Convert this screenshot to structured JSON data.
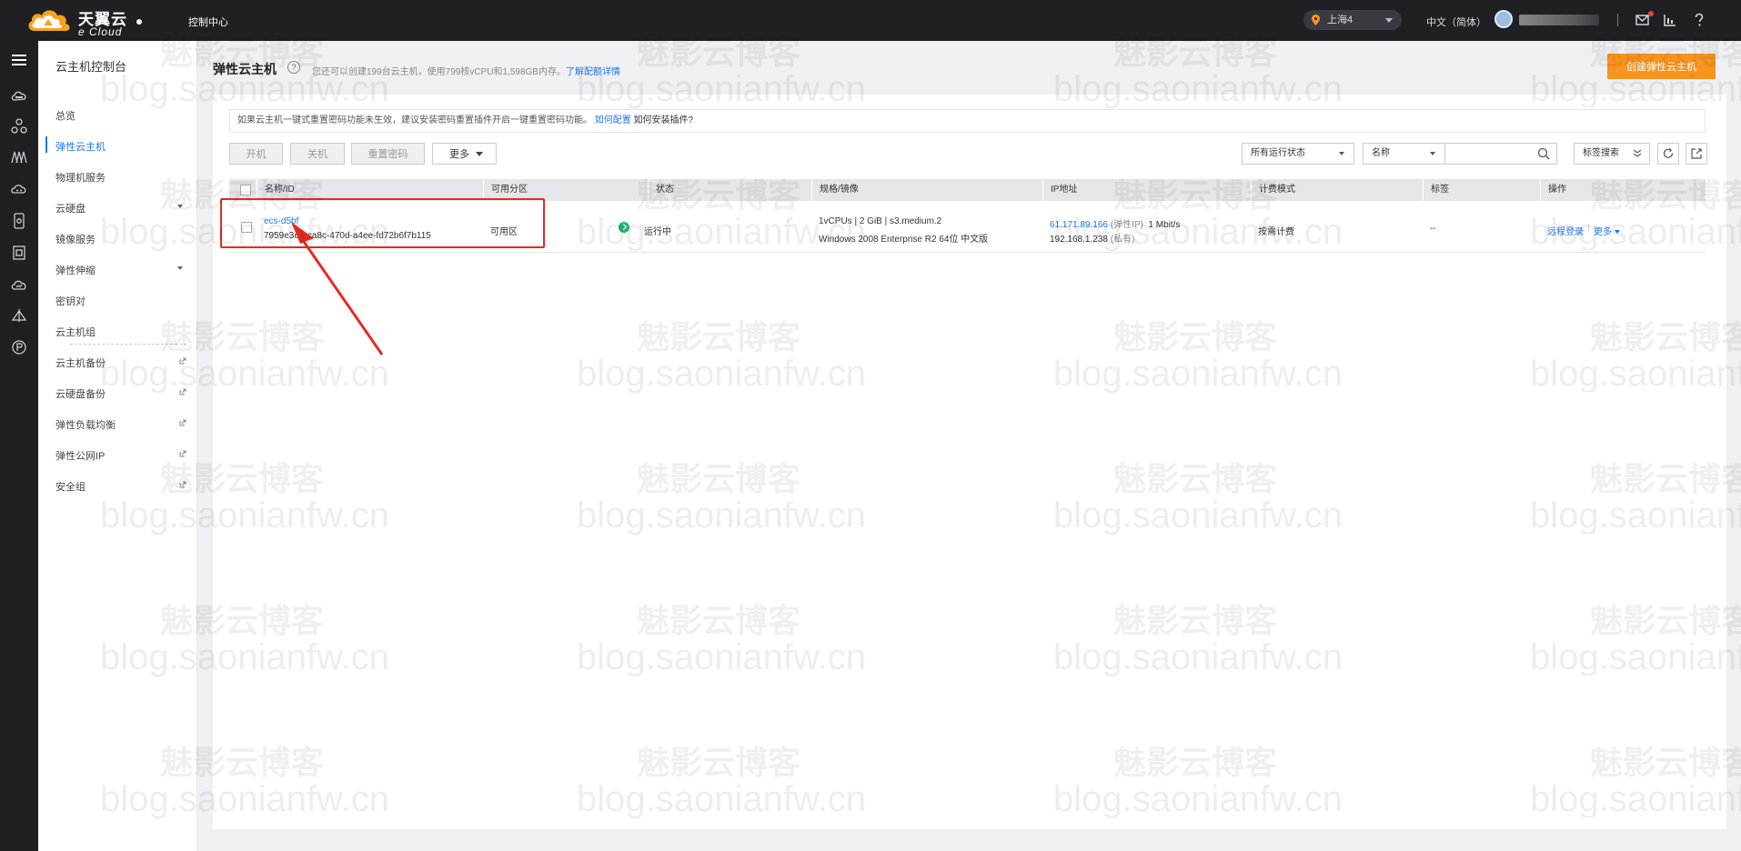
{
  "topbar": {
    "logo_cn": "天翼云",
    "logo_en": "e Cloud",
    "console": "控制中心",
    "region": "上海4",
    "language": "中文（简体）"
  },
  "sidenav": {
    "title": "云主机控制台",
    "items": [
      {
        "label": "总览"
      },
      {
        "label": "弹性云主机"
      },
      {
        "label": "物理机服务"
      },
      {
        "label": "云硬盘"
      },
      {
        "label": "镜像服务"
      },
      {
        "label": "弹性伸缩"
      },
      {
        "label": "密钥对"
      },
      {
        "label": "云主机组"
      },
      {
        "label": "云主机备份"
      },
      {
        "label": "云硬盘备份"
      },
      {
        "label": "弹性负载均衡"
      },
      {
        "label": "弹性公网IP"
      },
      {
        "label": "安全组"
      }
    ]
  },
  "page": {
    "title": "弹性云主机",
    "help": "?",
    "quota_text": "您还可以创建199台云主机，使用799核vCPU和1,598GB内存。",
    "quota_link": "了解配额详情",
    "create_button": "创建弹性云主机"
  },
  "notice": {
    "text": "如果云主机一键式重置密码功能未生效，建议安装密码重置插件开启一键重置密码功能。",
    "link1": "如何配置",
    "link2": "如何安装插件?"
  },
  "toolbar": {
    "start": "开机",
    "stop": "关机",
    "reset_password": "重置密码",
    "more": "更多",
    "status_filter": "所有运行状态",
    "search_field": "名称",
    "tag_search": "标签搜索"
  },
  "table": {
    "headers": [
      "名称/ID",
      "可用分区",
      "状态",
      "规格/镜像",
      "IP地址",
      "计费模式",
      "标签",
      "操作"
    ],
    "rows": [
      {
        "name": "ecs-d5bf",
        "id": "7959e3e0-ca8c-470d-a4ee-fd72b6f7b115",
        "zone": "可用区",
        "status": "运行中",
        "spec": "1vCPUs | 2 GiB | s3.medium.2",
        "image": "Windows 2008 Enterprise R2 64位 中文版",
        "eip": "61.171.89.166",
        "eip_label": "(弹性IP)",
        "bandwidth": "1 Mbit/s",
        "private_ip": "192.168.1.238",
        "private_label": "(私有)",
        "billing": "按需计费",
        "tags": "--",
        "op_remote": "远程登录",
        "op_more": "更多"
      }
    ]
  },
  "watermark": {
    "cn": "魅影云博客",
    "en": "blog.saonianfw.cn"
  },
  "colors": {
    "topbar": "#1f1f24",
    "accent": "#1e77e6",
    "create_button": "#f7941e",
    "running": "#22b573",
    "annotation": "#e52a22"
  }
}
